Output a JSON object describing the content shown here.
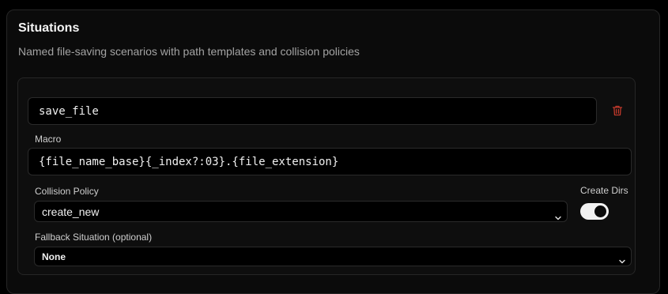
{
  "section": {
    "title": "Situations",
    "subtitle": "Named file-saving scenarios with path templates and collision policies"
  },
  "situation": {
    "name_value": "save_file",
    "delete_icon": "trash-icon",
    "macro_label": "Macro",
    "macro_value": "{file_name_base}{_index?:03}.{file_extension}",
    "collision_label": "Collision Policy",
    "collision_value": "create_new",
    "create_dirs_label": "Create Dirs",
    "create_dirs_enabled": true,
    "fallback_label": "Fallback Situation (optional)",
    "fallback_value": "None"
  },
  "colors": {
    "delete_icon": "#c0392b",
    "toggle_on": "#f2f2f2"
  }
}
